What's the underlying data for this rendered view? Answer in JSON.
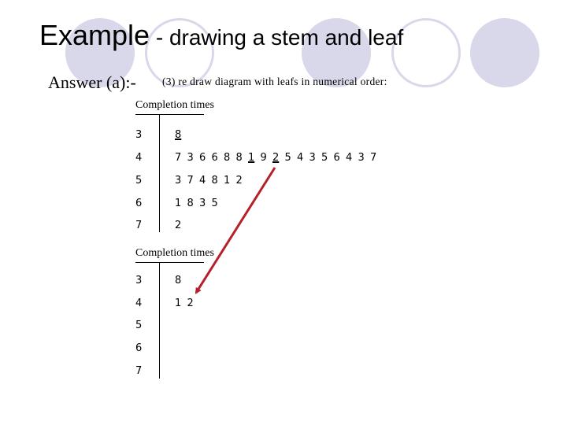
{
  "slide": {
    "title_main": "Example",
    "title_sub": " - drawing a stem and leaf",
    "answer_label": "Answer (a):-",
    "step_text": "(3)  re draw diagram with leafs in numerical order:",
    "decoration_color": "#d8d8ea",
    "arrow_color": "#b5202a"
  },
  "original_plot": {
    "title": "Completion times",
    "rows": [
      {
        "stem": "3",
        "leaves": [
          "8"
        ],
        "marked": [
          0
        ]
      },
      {
        "stem": "4",
        "leaves": [
          "7",
          "3",
          "6",
          "6",
          "8",
          "8",
          "1",
          "9",
          "2",
          "5",
          "4",
          "3",
          "5",
          "6",
          "4",
          "3",
          "7"
        ],
        "marked": [
          6,
          8
        ]
      },
      {
        "stem": "5",
        "leaves": [
          "3",
          "7",
          "4",
          "8",
          "1",
          "2"
        ],
        "marked": []
      },
      {
        "stem": "6",
        "leaves": [
          "1",
          "8",
          "3",
          "5"
        ],
        "marked": []
      },
      {
        "stem": "7",
        "leaves": [
          "2"
        ],
        "marked": []
      }
    ]
  },
  "ordered_plot": {
    "title": "Completion times",
    "rows": [
      {
        "stem": "3",
        "leaves": [
          "8"
        ],
        "marked": []
      },
      {
        "stem": "4",
        "leaves": [
          "1",
          "2"
        ],
        "marked": []
      },
      {
        "stem": "5",
        "leaves": [],
        "marked": []
      },
      {
        "stem": "6",
        "leaves": [],
        "marked": []
      },
      {
        "stem": "7",
        "leaves": [],
        "marked": []
      }
    ]
  }
}
